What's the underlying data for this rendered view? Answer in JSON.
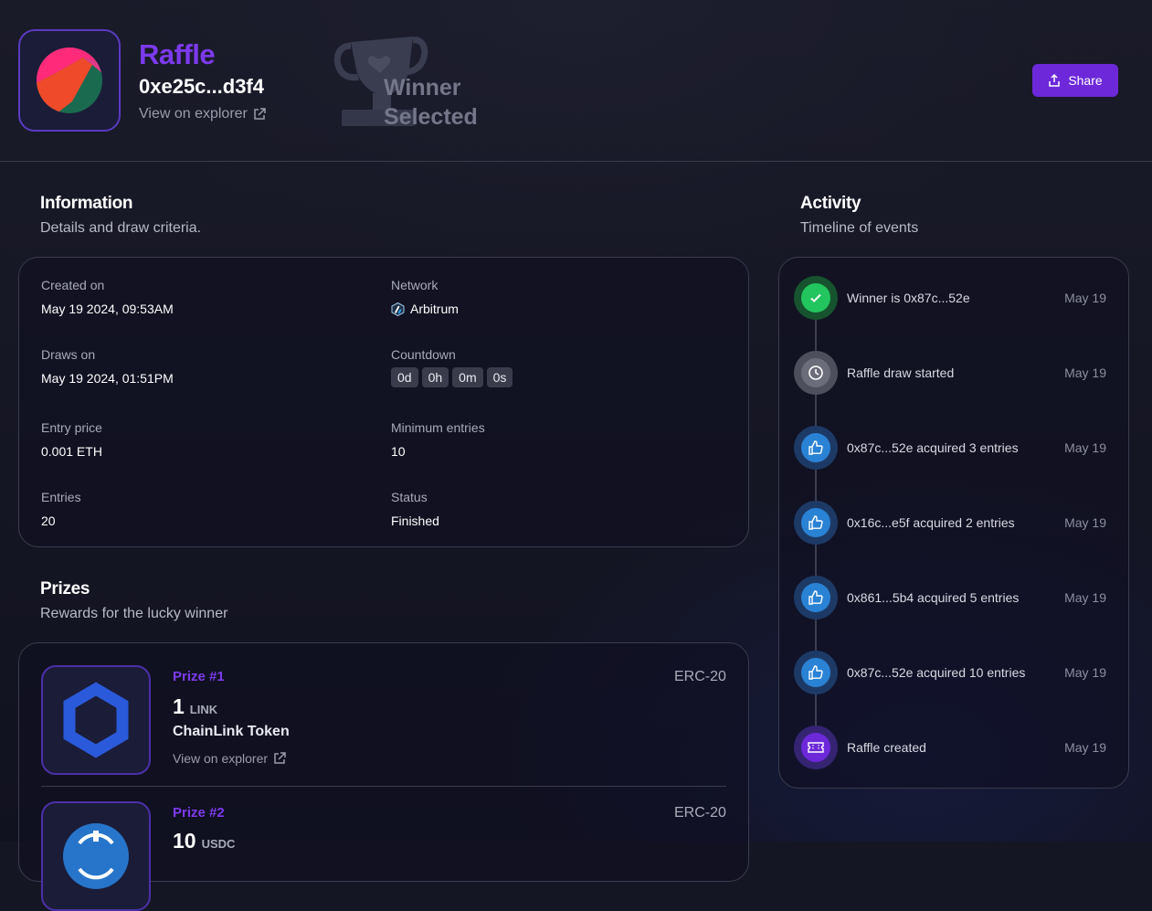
{
  "header": {
    "title": "Raffle",
    "address": "0xe25c...d3f4",
    "explorer_label": "View on explorer",
    "badge_line1": "Winner",
    "badge_line2": "Selected",
    "share_label": "Share"
  },
  "information": {
    "title": "Information",
    "subtitle": "Details and draw criteria.",
    "created_label": "Created on",
    "created_value": "May 19 2024, 09:53AM",
    "network_label": "Network",
    "network_value": "Arbitrum",
    "draws_label": "Draws on",
    "draws_value": "May 19 2024, 01:51PM",
    "countdown_label": "Countdown",
    "countdown": [
      "0d",
      "0h",
      "0m",
      "0s"
    ],
    "entry_price_label": "Entry price",
    "entry_price_value": "0.001 ETH",
    "min_entries_label": "Minimum entries",
    "min_entries_value": "10",
    "entries_label": "Entries",
    "entries_value": "20",
    "status_label": "Status",
    "status_value": "Finished"
  },
  "prizes": {
    "title": "Prizes",
    "subtitle": "Rewards for the lucky winner",
    "items": [
      {
        "number": "Prize #1",
        "type": "ERC-20",
        "amount": "1",
        "unit": "LINK",
        "name": "ChainLink Token",
        "explorer_label": "View on explorer"
      },
      {
        "number": "Prize #2",
        "type": "ERC-20",
        "amount": "10",
        "unit": "USDC"
      }
    ]
  },
  "activity": {
    "title": "Activity",
    "subtitle": "Timeline of events",
    "events": [
      {
        "text": "Winner is 0x87c...52e",
        "date": "May 19",
        "icon": "check-icon"
      },
      {
        "text": "Raffle draw started",
        "date": "May 19",
        "icon": "clock-icon"
      },
      {
        "text": "0x87c...52e acquired 3 entries",
        "date": "May 19",
        "icon": "thumbs-up-icon"
      },
      {
        "text": "0x16c...e5f acquired 2 entries",
        "date": "May 19",
        "icon": "thumbs-up-icon"
      },
      {
        "text": "0x861...5b4 acquired 5 entries",
        "date": "May 19",
        "icon": "thumbs-up-icon"
      },
      {
        "text": "0x87c...52e acquired 10 entries",
        "date": "May 19",
        "icon": "thumbs-up-icon"
      },
      {
        "text": "Raffle created",
        "date": "May 19",
        "icon": "ticket-icon"
      }
    ]
  },
  "colors": {
    "accent": "#7c3aed",
    "button": "#6d28d9",
    "success": "#22c55e",
    "info": "#2563eb"
  }
}
